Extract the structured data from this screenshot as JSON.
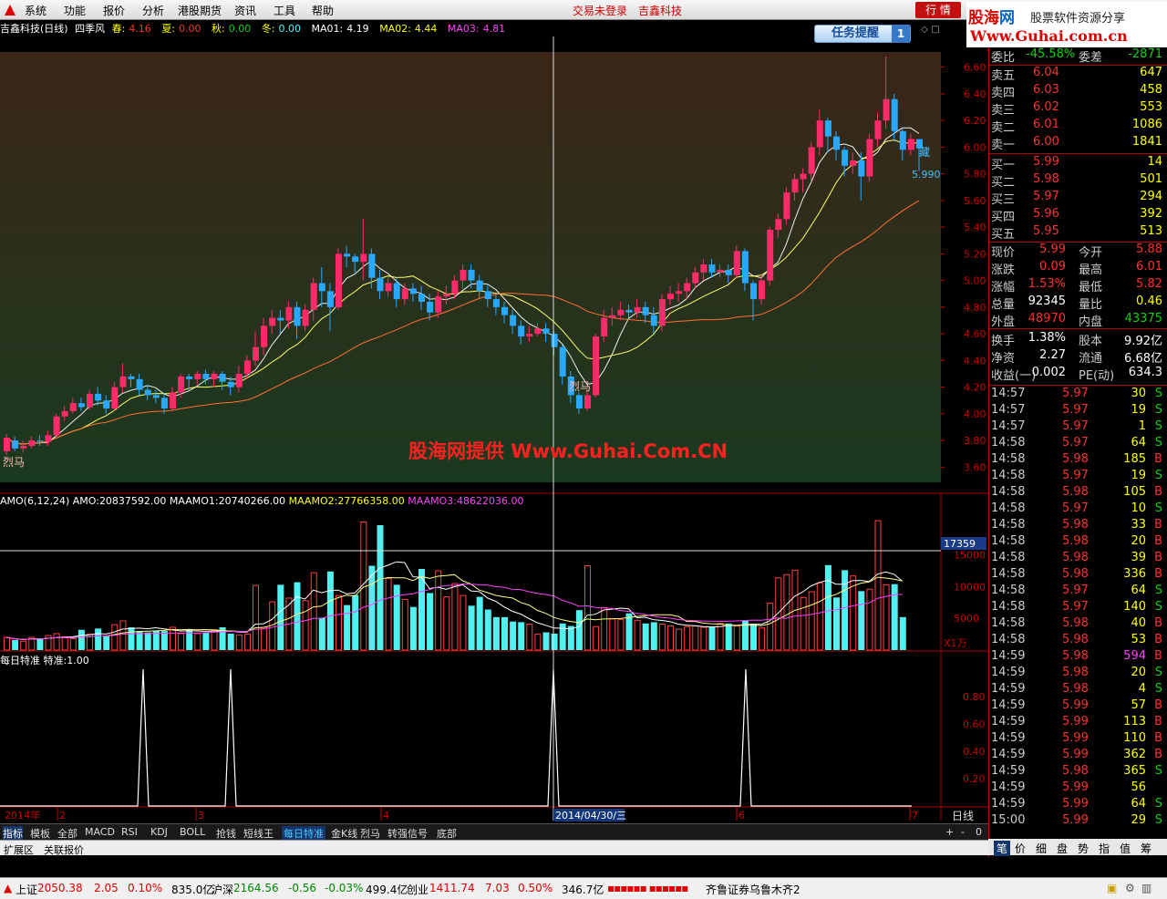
{
  "menu": {
    "items": [
      "系统",
      "功能",
      "报价",
      "分析",
      "港股期货",
      "资讯",
      "工具",
      "帮助"
    ],
    "warning": "交易未登录",
    "broker": "吉鑫科技",
    "hq_button": "行 情"
  },
  "brand": {
    "name_a": "股海",
    "name_b": "网",
    "slogan": "股票软件资源分享",
    "url": "Www.Guhai.com.cn"
  },
  "title_bar": {
    "stock": "吉鑫科技(日线)",
    "indicator": "四季风",
    "spring_label": "春:",
    "spring": "4.16",
    "summer_label": "夏:",
    "summer": "0.00",
    "autumn_label": "秋:",
    "autumn": "0.00",
    "winter_label": "冬:",
    "winter": "0.00",
    "ma1_label": "MA01:",
    "ma1": "4.19",
    "ma2_label": "MA02:",
    "ma2": "4.44",
    "ma3_label": "MA03:",
    "ma3": "4.81"
  },
  "task_button": {
    "label": "任务提醒",
    "count": "1"
  },
  "watermark": "股海网提供 Www.Guhai.Com.CN",
  "main_chart": {
    "y_ticks": [
      "6.60",
      "6.40",
      "6.20",
      "6.00",
      "5.80",
      "5.60",
      "5.40",
      "5.20",
      "5.00",
      "4.80",
      "4.60",
      "4.40",
      "4.20",
      "4.00",
      "3.80",
      "3.60"
    ],
    "labels": {
      "liema_left": "烈马",
      "liema_mid": "烈马",
      "hidden": "藏",
      "last_price": "5.990"
    }
  },
  "amo": {
    "name": "AMO(6,12,24)",
    "amo_label": "AMO:",
    "amo": "20837592.00",
    "m1_label": "MAAMO1:",
    "m1": "20740266.00",
    "m2_label": "MAAMO2:",
    "m2": "27766358.00",
    "m3_label": "MAAMO3:",
    "m3": "48622036.00",
    "y_ticks": [
      "15000",
      "10000",
      "5000"
    ],
    "cursor_value": "17359",
    "unit": "X1万"
  },
  "special": {
    "name": "每日特准",
    "label": "特准:",
    "value": "1.00",
    "y_ticks": [
      "0.80",
      "0.60",
      "0.40",
      "0.20"
    ]
  },
  "x_axis": {
    "year": "2014年",
    "months": [
      "2",
      "3",
      "4",
      "5",
      "6",
      "7"
    ],
    "cursor_date": "2014/04/30/三",
    "period": "日线"
  },
  "tabs": [
    "指标",
    "模板",
    "全部",
    "MACD",
    "RSI",
    "KDJ",
    "BOLL",
    "抢钱",
    "短线王",
    "每日特准",
    "金K线",
    "烈马",
    "转强信号",
    "底部"
  ],
  "tab_controls": [
    "+",
    "-",
    "0"
  ],
  "ext_tabs": [
    "扩展区",
    "关联报价"
  ],
  "quote": {
    "wb": {
      "label": "委比",
      "value": "-45.58%",
      "label2": "委差",
      "value2": "-2871"
    },
    "asks": [
      {
        "label": "卖五",
        "price": "6.04",
        "vol": "647"
      },
      {
        "label": "卖四",
        "price": "6.03",
        "vol": "458"
      },
      {
        "label": "卖三",
        "price": "6.02",
        "vol": "553"
      },
      {
        "label": "卖二",
        "price": "6.01",
        "vol": "1086"
      },
      {
        "label": "卖一",
        "price": "6.00",
        "vol": "1841"
      }
    ],
    "bids": [
      {
        "label": "买一",
        "price": "5.99",
        "vol": "14"
      },
      {
        "label": "买二",
        "price": "5.98",
        "vol": "501"
      },
      {
        "label": "买三",
        "price": "5.97",
        "vol": "294"
      },
      {
        "label": "买四",
        "price": "5.96",
        "vol": "392"
      },
      {
        "label": "买五",
        "price": "5.95",
        "vol": "513"
      }
    ],
    "stats": [
      {
        "l1": "现价",
        "v1": "5.99",
        "c1": "red",
        "l2": "今开",
        "v2": "5.88",
        "c2": "red"
      },
      {
        "l1": "涨跌",
        "v1": "0.09",
        "c1": "red",
        "l2": "最高",
        "v2": "6.01",
        "c2": "red"
      },
      {
        "l1": "涨幅",
        "v1": "1.53%",
        "c1": "red",
        "l2": "最低",
        "v2": "5.82",
        "c2": "red"
      },
      {
        "l1": "总量",
        "v1": "92345",
        "c1": "wht",
        "l2": "量比",
        "v2": "0.46",
        "c2": "yel"
      },
      {
        "l1": "外盘",
        "v1": "48970",
        "c1": "red",
        "l2": "内盘",
        "v2": "43375",
        "c2": "grn"
      },
      {
        "l1": "换手",
        "v1": "1.38%",
        "c1": "wht",
        "l2": "股本",
        "v2": "9.92亿",
        "c2": "wht"
      },
      {
        "l1": "净资",
        "v1": "2.27",
        "c1": "wht",
        "l2": "流通",
        "v2": "6.68亿",
        "c2": "wht"
      },
      {
        "l1": "收益(一)",
        "v1": "0.002",
        "c1": "wht",
        "l2": "PE(动)",
        "v2": "634.3",
        "c2": "wht"
      }
    ],
    "ticks": [
      {
        "t": "14:57",
        "p": "5.97",
        "v": "30",
        "s": "S"
      },
      {
        "t": "14:57",
        "p": "5.97",
        "v": "19",
        "s": "S"
      },
      {
        "t": "14:57",
        "p": "5.97",
        "v": "1",
        "s": "S"
      },
      {
        "t": "14:58",
        "p": "5.97",
        "v": "64",
        "s": "S"
      },
      {
        "t": "14:58",
        "p": "5.98",
        "v": "185",
        "s": "B"
      },
      {
        "t": "14:58",
        "p": "5.97",
        "v": "19",
        "s": "S"
      },
      {
        "t": "14:58",
        "p": "5.98",
        "v": "105",
        "s": "B"
      },
      {
        "t": "14:58",
        "p": "5.97",
        "v": "10",
        "s": "S"
      },
      {
        "t": "14:58",
        "p": "5.98",
        "v": "33",
        "s": "B"
      },
      {
        "t": "14:58",
        "p": "5.98",
        "v": "20",
        "s": "B"
      },
      {
        "t": "14:58",
        "p": "5.98",
        "v": "39",
        "s": "B"
      },
      {
        "t": "14:58",
        "p": "5.98",
        "v": "336",
        "s": "B"
      },
      {
        "t": "14:58",
        "p": "5.97",
        "v": "64",
        "s": "S"
      },
      {
        "t": "14:58",
        "p": "5.97",
        "v": "140",
        "s": "S"
      },
      {
        "t": "14:58",
        "p": "5.98",
        "v": "40",
        "s": "B"
      },
      {
        "t": "14:58",
        "p": "5.98",
        "v": "53",
        "s": "B"
      },
      {
        "t": "14:59",
        "p": "5.98",
        "v": "594",
        "s": "B"
      },
      {
        "t": "14:59",
        "p": "5.98",
        "v": "20",
        "s": "S"
      },
      {
        "t": "14:59",
        "p": "5.98",
        "v": "4",
        "s": "S"
      },
      {
        "t": "14:59",
        "p": "5.99",
        "v": "57",
        "s": "B"
      },
      {
        "t": "14:59",
        "p": "5.99",
        "v": "113",
        "s": "B"
      },
      {
        "t": "14:59",
        "p": "5.99",
        "v": "110",
        "s": "B"
      },
      {
        "t": "14:59",
        "p": "5.99",
        "v": "362",
        "s": "B"
      },
      {
        "t": "14:59",
        "p": "5.98",
        "v": "365",
        "s": "S"
      },
      {
        "t": "14:59",
        "p": "5.99",
        "v": "56",
        "s": ""
      },
      {
        "t": "14:59",
        "p": "5.99",
        "v": "64",
        "s": "S"
      },
      {
        "t": "15:00",
        "p": "5.99",
        "v": "29",
        "s": "S"
      }
    ]
  },
  "right_tabs": [
    "笔",
    "价",
    "细",
    "盘",
    "势",
    "指",
    "值",
    "筹"
  ],
  "status": {
    "sh_label": "上证",
    "sh": "2050.38",
    "sh_chg": "2.05",
    "sh_pct": "0.10%",
    "sh_amt": "835.0亿",
    "sz_label": "沪深",
    "sz": "2164.56",
    "sz_chg": "-0.56",
    "sz_pct": "-0.03%",
    "sz_amt": "499.4亿",
    "cy_label": "创业",
    "cy": "1411.74",
    "cy_chg": "7.03",
    "cy_pct": "0.50%",
    "cy_amt": "346.7亿",
    "broker_line": "齐鲁证券乌鲁木齐2"
  },
  "chart_data": {
    "type": "candlestick",
    "price_range": [
      3.5,
      6.7
    ],
    "candles": [
      [
        3.72,
        3.82,
        3.69,
        3.85
      ],
      [
        3.8,
        3.74,
        3.72,
        3.83
      ],
      [
        3.74,
        3.76,
        3.71,
        3.8
      ],
      [
        3.76,
        3.8,
        3.74,
        3.83
      ],
      [
        3.8,
        3.79,
        3.76,
        3.84
      ],
      [
        3.79,
        3.84,
        3.76,
        3.87
      ],
      [
        3.84,
        3.98,
        3.82,
        4.0
      ],
      [
        3.98,
        4.02,
        3.95,
        4.06
      ],
      [
        4.02,
        4.08,
        4.0,
        4.12
      ],
      [
        4.08,
        4.05,
        4.02,
        4.12
      ],
      [
        4.05,
        4.15,
        4.03,
        4.18
      ],
      [
        4.15,
        4.1,
        4.06,
        4.2
      ],
      [
        4.1,
        4.04,
        4.0,
        4.14
      ],
      [
        4.04,
        4.2,
        4.02,
        4.24
      ],
      [
        4.2,
        4.28,
        4.16,
        4.38
      ],
      [
        4.28,
        4.26,
        4.2,
        4.3
      ],
      [
        4.26,
        4.18,
        4.14,
        4.3
      ],
      [
        4.18,
        4.14,
        4.1,
        4.22
      ],
      [
        4.14,
        4.12,
        4.08,
        4.18
      ],
      [
        4.12,
        4.04,
        4.0,
        4.16
      ],
      [
        4.04,
        4.16,
        4.02,
        4.2
      ],
      [
        4.16,
        4.28,
        4.12,
        4.3
      ],
      [
        4.28,
        4.26,
        4.18,
        4.3
      ],
      [
        4.26,
        4.3,
        4.22,
        4.32
      ],
      [
        4.3,
        4.26,
        4.22,
        4.33
      ],
      [
        4.26,
        4.3,
        4.2,
        4.32
      ],
      [
        4.3,
        4.24,
        4.18,
        4.32
      ],
      [
        4.24,
        4.2,
        4.14,
        4.28
      ],
      [
        4.2,
        4.3,
        4.16,
        4.36
      ],
      [
        4.3,
        4.4,
        4.26,
        4.44
      ],
      [
        4.4,
        4.5,
        4.36,
        4.62
      ],
      [
        4.5,
        4.66,
        4.44,
        4.72
      ],
      [
        4.66,
        4.72,
        4.6,
        4.78
      ],
      [
        4.72,
        4.7,
        4.6,
        4.78
      ],
      [
        4.7,
        4.8,
        4.64,
        4.84
      ],
      [
        4.8,
        4.66,
        4.56,
        4.84
      ],
      [
        4.66,
        4.78,
        4.62,
        4.82
      ],
      [
        4.78,
        4.98,
        4.7,
        5.02
      ],
      [
        4.98,
        4.92,
        4.8,
        5.1
      ],
      [
        4.92,
        4.8,
        4.62,
        4.98
      ],
      [
        4.8,
        5.2,
        4.78,
        5.24
      ],
      [
        5.2,
        5.18,
        5.1,
        5.26
      ],
      [
        5.18,
        5.14,
        5.06,
        5.2
      ],
      [
        5.14,
        5.2,
        5.0,
        5.46
      ],
      [
        5.2,
        5.02,
        4.94,
        5.24
      ],
      [
        5.02,
        4.92,
        4.86,
        5.08
      ],
      [
        4.92,
        4.98,
        4.88,
        5.02
      ],
      [
        4.98,
        4.86,
        4.8,
        5.02
      ],
      [
        4.86,
        4.94,
        4.82,
        4.98
      ],
      [
        4.94,
        4.9,
        4.84,
        4.98
      ],
      [
        4.9,
        4.84,
        4.78,
        4.96
      ],
      [
        4.84,
        4.76,
        4.7,
        4.9
      ],
      [
        4.76,
        4.88,
        4.72,
        4.92
      ],
      [
        4.88,
        4.9,
        4.82,
        4.96
      ],
      [
        4.9,
        5.0,
        4.86,
        5.04
      ],
      [
        5.0,
        5.08,
        4.94,
        5.12
      ],
      [
        5.08,
        5.0,
        4.94,
        5.12
      ],
      [
        5.0,
        4.92,
        4.86,
        5.04
      ],
      [
        4.92,
        4.86,
        4.8,
        4.96
      ],
      [
        4.86,
        4.8,
        4.74,
        4.9
      ],
      [
        4.8,
        4.74,
        4.68,
        4.84
      ],
      [
        4.74,
        4.66,
        4.6,
        4.78
      ],
      [
        4.66,
        4.58,
        4.52,
        4.7
      ],
      [
        4.58,
        4.6,
        4.54,
        4.66
      ],
      [
        4.6,
        4.64,
        4.58,
        4.68
      ],
      [
        4.64,
        4.6,
        4.54,
        4.68
      ],
      [
        4.6,
        4.5,
        4.44,
        4.62
      ],
      [
        4.5,
        4.28,
        4.22,
        4.52
      ],
      [
        4.28,
        4.14,
        4.08,
        4.32
      ],
      [
        4.14,
        4.04,
        4.0,
        4.16
      ],
      [
        4.04,
        4.14,
        4.02,
        4.18
      ],
      [
        4.14,
        4.58,
        4.12,
        4.6
      ],
      [
        4.58,
        4.72,
        4.54,
        4.78
      ],
      [
        4.72,
        4.74,
        4.66,
        4.8
      ],
      [
        4.74,
        4.78,
        4.7,
        4.84
      ],
      [
        4.78,
        4.76,
        4.72,
        4.82
      ],
      [
        4.76,
        4.8,
        4.72,
        4.86
      ],
      [
        4.8,
        4.74,
        4.68,
        4.84
      ],
      [
        4.74,
        4.66,
        4.6,
        4.8
      ],
      [
        4.66,
        4.86,
        4.62,
        4.9
      ],
      [
        4.86,
        4.9,
        4.82,
        4.96
      ],
      [
        4.9,
        4.92,
        4.84,
        4.98
      ],
      [
        4.92,
        4.98,
        4.86,
        5.02
      ],
      [
        4.98,
        5.06,
        4.94,
        5.1
      ],
      [
        5.06,
        5.12,
        5.0,
        5.16
      ],
      [
        5.12,
        5.06,
        5.02,
        5.16
      ],
      [
        5.06,
        5.08,
        5.02,
        5.12
      ],
      [
        5.08,
        5.04,
        4.98,
        5.12
      ],
      [
        5.04,
        5.22,
        5.02,
        5.26
      ],
      [
        5.22,
        4.98,
        4.92,
        5.24
      ],
      [
        4.98,
        4.86,
        4.7,
        5.0
      ],
      [
        4.86,
        5.0,
        4.82,
        5.04
      ],
      [
        5.0,
        5.38,
        4.96,
        5.4
      ],
      [
        5.38,
        5.46,
        5.32,
        5.5
      ],
      [
        5.46,
        5.66,
        5.42,
        5.7
      ],
      [
        5.66,
        5.76,
        5.6,
        5.8
      ],
      [
        5.76,
        5.8,
        5.66,
        5.84
      ],
      [
        5.8,
        6.0,
        5.74,
        6.04
      ],
      [
        6.0,
        6.2,
        5.94,
        6.28
      ],
      [
        6.2,
        6.08,
        5.96,
        6.22
      ],
      [
        6.08,
        5.98,
        5.9,
        6.12
      ],
      [
        5.98,
        5.86,
        5.78,
        6.0
      ],
      [
        5.86,
        5.9,
        5.8,
        5.96
      ],
      [
        5.9,
        5.78,
        5.6,
        5.96
      ],
      [
        5.78,
        6.06,
        5.74,
        6.1
      ],
      [
        6.06,
        6.2,
        6.0,
        6.26
      ],
      [
        6.2,
        6.36,
        6.14,
        6.68
      ],
      [
        6.36,
        6.12,
        6.04,
        6.4
      ],
      [
        6.12,
        5.98,
        5.9,
        6.14
      ],
      [
        5.98,
        6.06,
        5.94,
        6.1
      ],
      [
        6.06,
        5.99,
        5.82,
        6.01
      ]
    ],
    "amo_values": [
      2,
      1.6,
      1.4,
      2,
      1.8,
      2.3,
      2.6,
      2.1,
      1.8,
      3.2,
      2.5,
      3.4,
      2.2,
      4,
      4.6,
      3.6,
      3,
      2.8,
      3.1,
      3,
      3.6,
      2.6,
      3.2,
      2.6,
      2.8,
      3.2,
      3.6,
      2.6,
      2.4,
      2.5,
      10.2,
      3.6,
      7.6,
      10.3,
      8.2,
      10.7,
      7.8,
      12.2,
      5.1,
      12.4,
      8.6,
      7.1,
      8.7,
      20.2,
      13.3,
      19.7,
      11.3,
      10.3,
      8,
      6.8,
      12.8,
      9,
      12.5,
      8.4,
      10.5,
      8.6,
      7,
      8.4,
      6.4,
      5.2,
      5.2,
      4.5,
      4.4,
      4.1,
      2.5,
      2.8,
      2.6,
      4.2,
      3.8,
      6.3,
      13.3,
      3.7,
      6.7,
      4.9,
      4.8,
      5.8,
      4.7,
      4.2,
      4.4,
      4.1,
      3.8,
      3.3,
      3.7,
      3.8,
      3.6,
      3.7,
      4.2,
      4.2,
      3.8,
      4.6,
      4.1,
      3.5,
      7.4,
      11.4,
      11.9,
      12.6,
      8.3,
      9.2,
      10.6,
      13.4,
      8.3,
      12.6,
      11.7,
      9.3,
      9.6,
      20.4,
      10.3,
      10.4,
      5.2
    ],
    "special_signal_positions": [
      25,
      41,
      101,
      135
    ]
  }
}
